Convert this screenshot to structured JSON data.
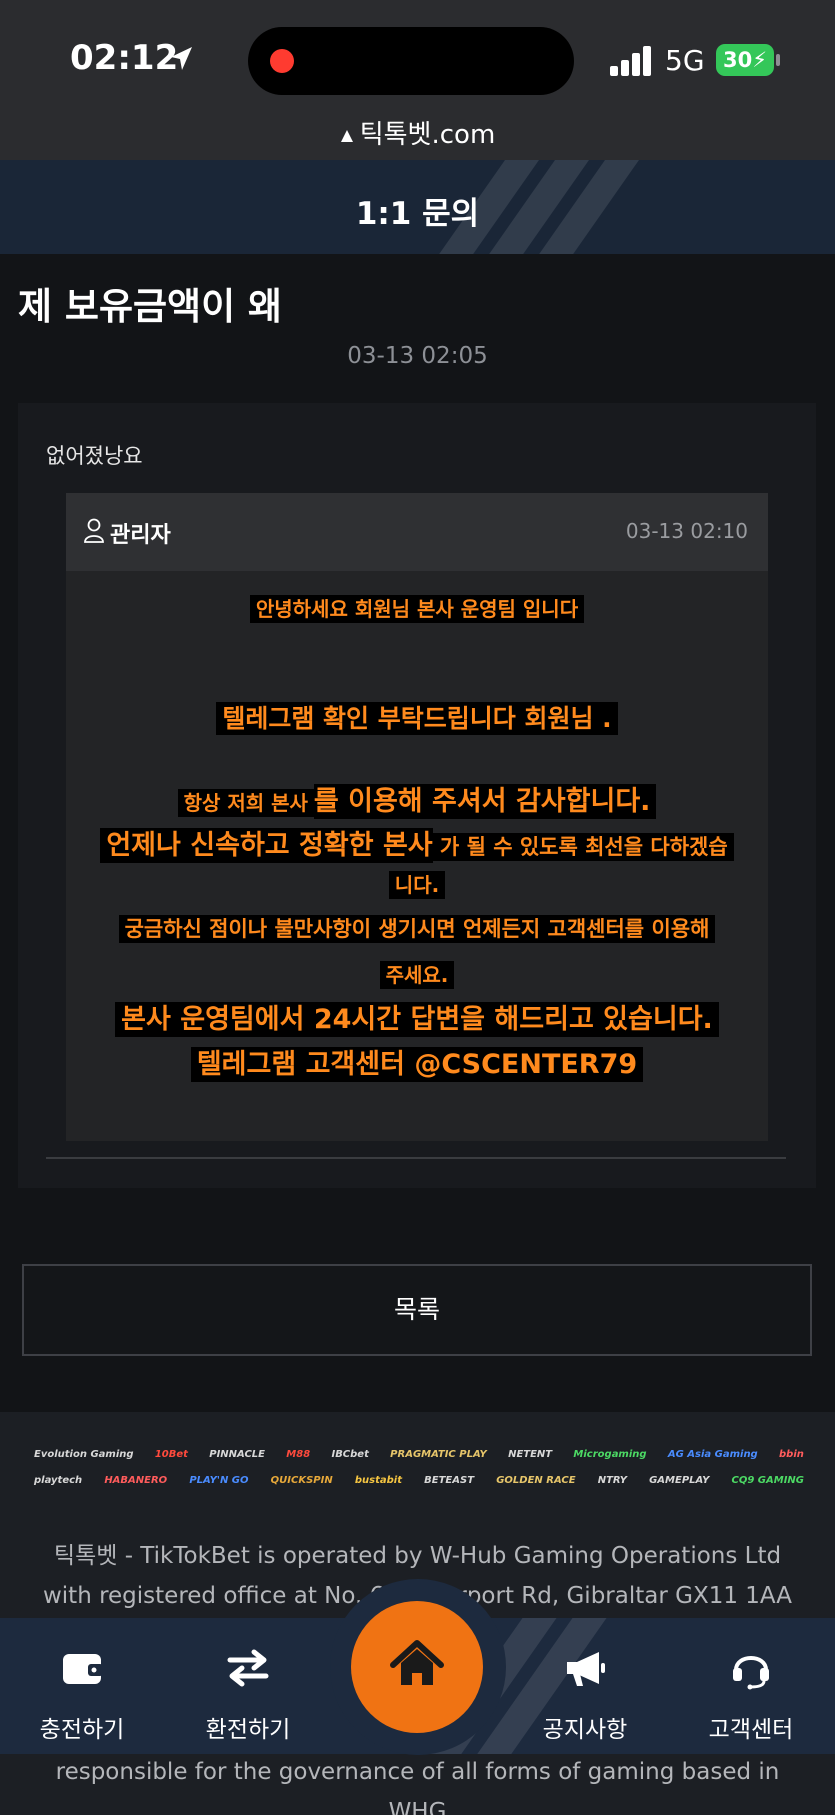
{
  "status_bar": {
    "time": "02:12",
    "network": "5G",
    "battery": "30",
    "url": "틱톡벳.com"
  },
  "header": {
    "title": "1:1 문의"
  },
  "post": {
    "title": "제 보유금액이 왜",
    "date": "03-13 02:05",
    "question": "없어졌낭요",
    "reply": {
      "author": "관리자",
      "date": "03-13 02:10",
      "lines": [
        "안녕하세요 회원님 본사 운영팀 입니다",
        "텔레그램 확인 부탁드립니다 회원님 .",
        "항상 저희 본사",
        "를 이용해 주셔서 감사합니다.",
        "언제나 신속하고 정확한 본사",
        " 가 될 수 있도록 최선을 다하겠습",
        "니다.",
        "궁금하신 점이나 불만사항이 생기시면 언제든지 고객센터를 이용해",
        "주세요.",
        "본사 운영팀에서 24시간 답변을 해드리고 있습니다.",
        "텔레그램 고객센터 @CSCENTER79"
      ]
    }
  },
  "list_button": "목록",
  "footer": {
    "providers_row1": [
      "Evolution Gaming",
      "10Bet",
      "PINNACLE",
      "M88",
      "IBCbet",
      "PRAGMATIC PLAY",
      "NETENT",
      "Microgaming",
      "AG Asia Gaming",
      "bbin"
    ],
    "providers_row2": [
      "playtech",
      "HABANERO",
      "PLAY'N GO",
      "QUICKSPIN",
      "bustabit",
      "BETEAST",
      "GOLDEN RACE",
      "NTRY",
      "GAMEPLAY",
      "CQ9 GAMING"
    ],
    "text_line1": "틱톡벳 - TikTokBet is operated by W-Hub Gaming Operations Ltd",
    "text_line2": "with registered office at No. 6/... ...erport Rd, Gibraltar GX11 1AA",
    "text_line3": "responsible for the governance of all forms of gaming based in",
    "text_line4": "WHG"
  },
  "nav": {
    "deposit": "충전하기",
    "withdraw": "환전하기",
    "notice": "공지사항",
    "support": "고객센터"
  },
  "colors": {
    "accent": "#f07313",
    "highlight_text": "#ff8a1d",
    "nav_bg": "#1d2a3e"
  }
}
